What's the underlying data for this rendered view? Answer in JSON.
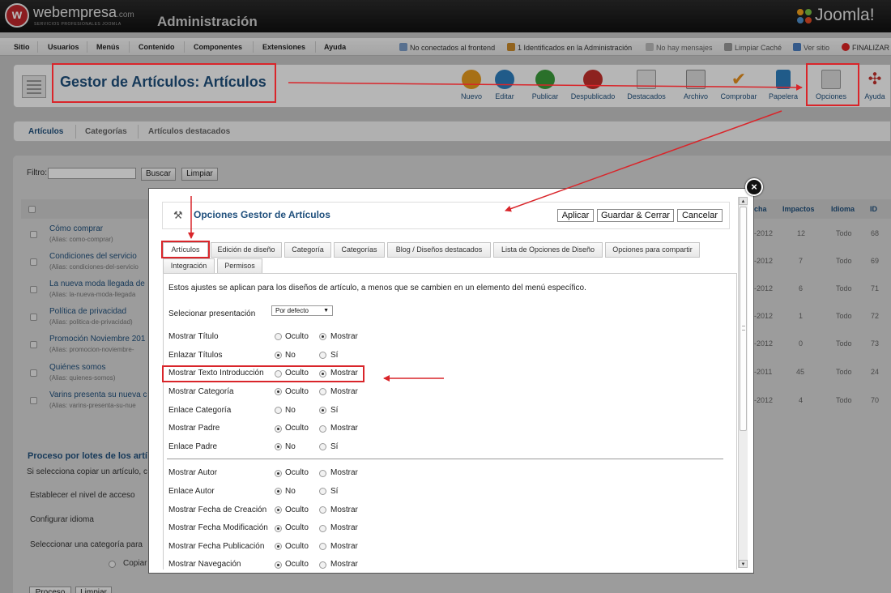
{
  "header": {
    "brand": "webempresa",
    "brand_suffix": ".com",
    "brand_tagline": "servicios profesionales joomla",
    "section_title": "Administración",
    "joomla_logo": "Joomla!"
  },
  "menu": {
    "items": [
      "Sitio",
      "Usuarios",
      "Menús",
      "Contenido",
      "Componentes",
      "Extensiones",
      "Ayuda"
    ],
    "status": [
      {
        "icon": "users-icon",
        "text": "No conectados al frontend"
      },
      {
        "icon": "admin-users-icon",
        "text": "1 Identificados en la Administración"
      },
      {
        "icon": "mail-icon",
        "text": "No hay mensajes"
      },
      {
        "icon": "broom-icon",
        "text": "Limpiar Caché"
      },
      {
        "icon": "monitor-icon",
        "text": "Ver sitio"
      },
      {
        "icon": "logout-icon",
        "text": "FINALIZAR"
      }
    ]
  },
  "toolbar": {
    "page_title": "Gestor de Artículos: Artículos",
    "buttons": [
      {
        "label": "Nuevo",
        "icon": "plus-icon",
        "color": "#e89b1e"
      },
      {
        "label": "Editar",
        "icon": "pencil-icon",
        "color": "#2d7fbe"
      },
      {
        "label": "Publicar",
        "icon": "check-icon",
        "color": "#3b9c3b"
      },
      {
        "label": "Despublicado",
        "icon": "circle-icon",
        "color": "#c4302b"
      },
      {
        "label": "Destacados",
        "icon": "star-icon",
        "color": "#888888"
      },
      {
        "label": "Archivo",
        "icon": "archive-icon",
        "color": "#777777"
      },
      {
        "label": "Comprobar",
        "icon": "checkmark-icon",
        "color": "#e8901e"
      },
      {
        "label": "Papelera",
        "icon": "trash-icon",
        "color": "#2d7fbe"
      },
      {
        "label": "Opciones",
        "icon": "options-icon",
        "color": "#888888"
      },
      {
        "label": "Ayuda",
        "icon": "help-icon",
        "color": "#c4302b"
      }
    ]
  },
  "subtabs": [
    "Artículos",
    "Categorías",
    "Artículos destacados"
  ],
  "filter": {
    "label": "Filtro:",
    "search_button": "Buscar",
    "clear_button": "Limpiar"
  },
  "list": {
    "columns_right": [
      "cha",
      "Impactos",
      "Idioma",
      "ID"
    ],
    "rows": [
      {
        "title": "Cómo comprar",
        "alias": "(Alias: como-comprar)",
        "date": "-2012",
        "hits": "12",
        "lang": "Todo",
        "id": "68"
      },
      {
        "title": "Condiciones del servicio",
        "alias": "(Alias: condiciones-del-servicio",
        "date": "-2012",
        "hits": "7",
        "lang": "Todo",
        "id": "69"
      },
      {
        "title": "La nueva moda llegada de",
        "alias": "(Alias: la-nueva-moda-llegada",
        "date": "-2012",
        "hits": "6",
        "lang": "Todo",
        "id": "71"
      },
      {
        "title": "Política de privacidad",
        "alias": "(Alias: politica-de-privacidad)",
        "date": "-2012",
        "hits": "1",
        "lang": "Todo",
        "id": "72"
      },
      {
        "title": "Promoción Noviembre 201",
        "alias": "(Alias: promocion-noviembre-",
        "date": "-2012",
        "hits": "0",
        "lang": "Todo",
        "id": "73"
      },
      {
        "title": "Quiénes somos",
        "alias": "(Alias: quienes-somos)",
        "date": "-2011",
        "hits": "45",
        "lang": "Todo",
        "id": "24"
      },
      {
        "title": "Varins presenta su nueva c",
        "alias": "(Alias: varins-presenta-su-nue",
        "date": "-2012",
        "hits": "4",
        "lang": "Todo",
        "id": "70"
      }
    ]
  },
  "batch": {
    "title": "Proceso por lotes de los artí",
    "intro": "Si selecciona copiar un artículo, c",
    "access": "Establecer el nivel de acceso",
    "language": "Configurar idioma",
    "category": "Seleccionar una categoría para",
    "copy": "Copiar",
    "process_button": "Proceso",
    "clear_button": "Limpiar"
  },
  "modal": {
    "title": "Opciones Gestor de Artículos",
    "apply": "Aplicar",
    "save_close": "Guardar & Cerrar",
    "cancel": "Cancelar",
    "close_symbol": "×",
    "tabs": [
      "Artículos",
      "Edición de diseño",
      "Categoría",
      "Categorías",
      "Blog / Diseños destacados",
      "Lista de Opciones de Diseño",
      "Opciones para compartir",
      "Integración",
      "Permisos"
    ],
    "intro": "Estos ajustes se aplican para los diseños de artículo, a menos que se cambien en un elemento del menú específico.",
    "layout_label": "Selecionar presentación",
    "layout_value": "Por defecto",
    "options": [
      {
        "label": "Mostrar Título",
        "a": "Oculto",
        "b": "Mostrar",
        "selected": "b"
      },
      {
        "label": "Enlazar Títulos",
        "a": "No",
        "b": "Sí",
        "selected": "a"
      },
      {
        "label": "Mostrar Texto Introducción",
        "a": "Oculto",
        "b": "Mostrar",
        "selected": "b"
      },
      {
        "label": "Mostrar Categoría",
        "a": "Oculto",
        "b": "Mostrar",
        "selected": "a"
      },
      {
        "label": "Enlace Categoría",
        "a": "No",
        "b": "Sí",
        "selected": "b"
      },
      {
        "label": "Mostrar Padre",
        "a": "Oculto",
        "b": "Mostrar",
        "selected": "a"
      },
      {
        "label": "Enlace Padre",
        "a": "No",
        "b": "Sí",
        "selected": "a"
      },
      {
        "label": "Mostrar Autor",
        "a": "Oculto",
        "b": "Mostrar",
        "selected": "a"
      },
      {
        "label": "Enlace Autor",
        "a": "No",
        "b": "Sí",
        "selected": "a"
      },
      {
        "label": "Mostrar Fecha de Creación",
        "a": "Oculto",
        "b": "Mostrar",
        "selected": "a"
      },
      {
        "label": "Mostrar Fecha Modificación",
        "a": "Oculto",
        "b": "Mostrar",
        "selected": "a"
      },
      {
        "label": "Mostrar Fecha Publicación",
        "a": "Oculto",
        "b": "Mostrar",
        "selected": "a"
      },
      {
        "label": "Mostrar Navegación",
        "a": "Oculto",
        "b": "Mostrar",
        "selected": "a"
      }
    ]
  },
  "colors": {
    "accent_blue": "#1f4f7c",
    "highlight_red": "#d9252a"
  }
}
